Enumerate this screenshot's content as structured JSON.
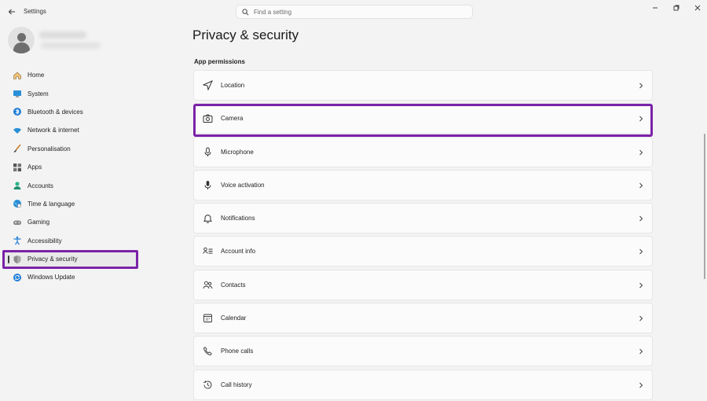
{
  "window": {
    "title": "Settings"
  },
  "search": {
    "placeholder": "Find a setting"
  },
  "page": {
    "title": "Privacy & security",
    "section": "App permissions"
  },
  "sidebar": {
    "items": [
      {
        "label": "Home",
        "icon": "home-icon"
      },
      {
        "label": "System",
        "icon": "system-icon"
      },
      {
        "label": "Bluetooth & devices",
        "icon": "bluetooth-icon"
      },
      {
        "label": "Network & internet",
        "icon": "wifi-icon"
      },
      {
        "label": "Personalisation",
        "icon": "brush-icon"
      },
      {
        "label": "Apps",
        "icon": "apps-icon"
      },
      {
        "label": "Accounts",
        "icon": "accounts-icon"
      },
      {
        "label": "Time & language",
        "icon": "globe-clock-icon"
      },
      {
        "label": "Gaming",
        "icon": "gamepad-icon"
      },
      {
        "label": "Accessibility",
        "icon": "accessibility-icon"
      },
      {
        "label": "Privacy & security",
        "icon": "shield-icon",
        "selected": true
      },
      {
        "label": "Windows Update",
        "icon": "update-icon"
      }
    ]
  },
  "permissions": [
    {
      "label": "Location",
      "icon": "location-icon"
    },
    {
      "label": "Camera",
      "icon": "camera-icon"
    },
    {
      "label": "Microphone",
      "icon": "microphone-icon"
    },
    {
      "label": "Voice activation",
      "icon": "voice-activation-icon"
    },
    {
      "label": "Notifications",
      "icon": "bell-icon"
    },
    {
      "label": "Account info",
      "icon": "account-info-icon"
    },
    {
      "label": "Contacts",
      "icon": "contacts-icon"
    },
    {
      "label": "Calendar",
      "icon": "calendar-icon"
    },
    {
      "label": "Phone calls",
      "icon": "phone-icon"
    },
    {
      "label": "Call history",
      "icon": "call-history-icon"
    }
  ],
  "colors": {
    "highlight": "#7b22a8",
    "accent": "#0067c0"
  }
}
